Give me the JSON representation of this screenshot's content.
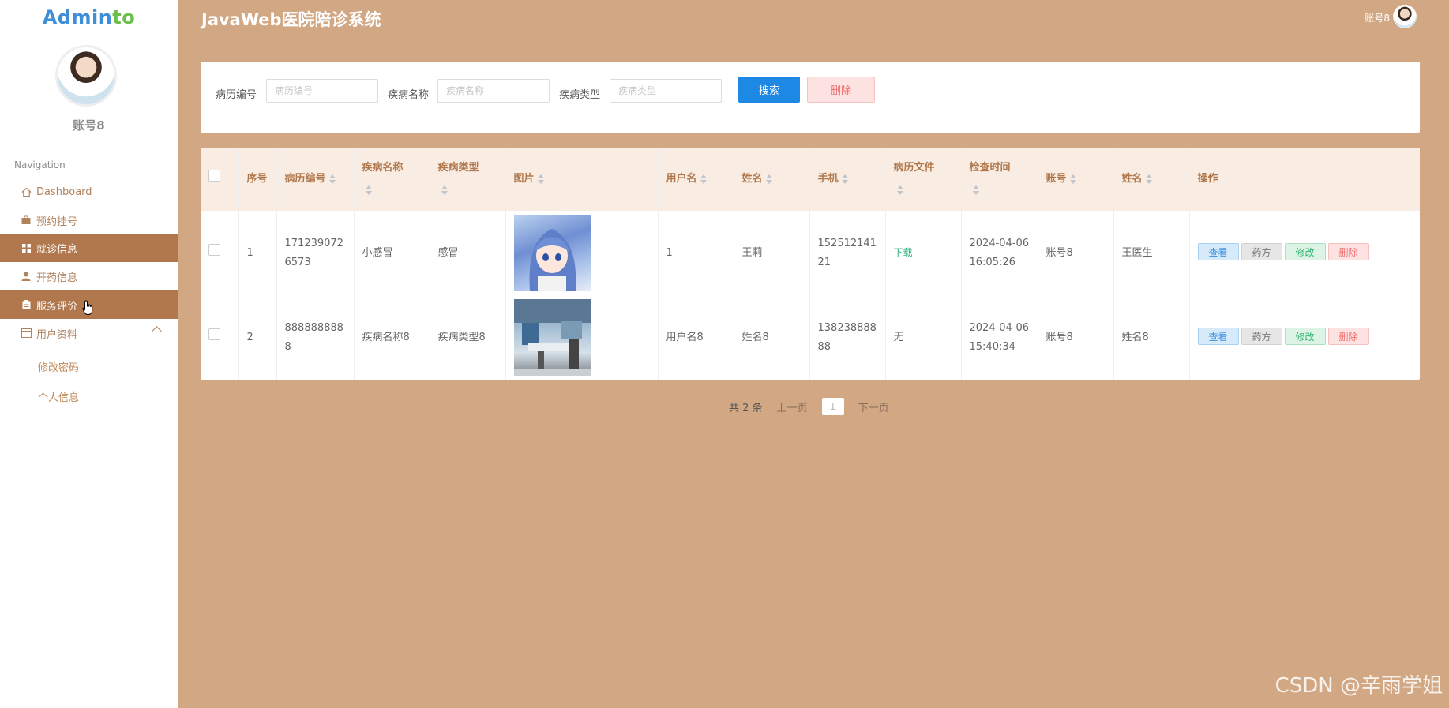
{
  "app": {
    "logo": "Adminto",
    "title": "JavaWeb医院陪诊系统",
    "username": "账号8",
    "header_user": "账号8"
  },
  "sidebar": {
    "heading": "Navigation",
    "items": [
      {
        "label": "Dashboard",
        "icon": "home-icon",
        "active": false
      },
      {
        "label": "预约挂号",
        "icon": "briefcase-icon",
        "active": false
      },
      {
        "label": "就诊信息",
        "icon": "grid-icon",
        "active": true
      },
      {
        "label": "开药信息",
        "icon": "user-icon",
        "active": false
      },
      {
        "label": "服务评价",
        "icon": "clipboard-icon",
        "active": true
      },
      {
        "label": "用户资料",
        "icon": "profile-card-icon",
        "active": false
      }
    ],
    "sub_items": [
      {
        "label": "修改密码"
      },
      {
        "label": "个人信息"
      }
    ]
  },
  "search": {
    "fields": [
      {
        "label": "病历编号",
        "placeholder": "病历编号",
        "value": ""
      },
      {
        "label": "疾病名称",
        "placeholder": "疾病名称",
        "value": ""
      },
      {
        "label": "疾病类型",
        "placeholder": "疾病类型",
        "value": ""
      }
    ],
    "search_button": "搜索",
    "delete_button": "删除"
  },
  "table": {
    "headers": [
      "序号",
      "病历编号",
      "疾病名称",
      "疾病类型",
      "图片",
      "用户名",
      "姓名",
      "手机",
      "病历文件",
      "检查时间",
      "账号",
      "姓名",
      "操作"
    ],
    "rows": [
      {
        "index": "1",
        "record_no": "1712390726573",
        "disease_name": "小感冒",
        "disease_type": "感冒",
        "image": "anime-girl-image",
        "user_name": "1",
        "name": "王莉",
        "phone": "15251214121",
        "file": "下载",
        "check_time": "2024-04-06 16:05:26",
        "account": "账号8",
        "doctor_name": "王医生"
      },
      {
        "index": "2",
        "record_no": "8888888888",
        "disease_name": "疾病名称8",
        "disease_type": "疾病类型8",
        "image": "operating-room-image",
        "user_name": "用户名8",
        "name": "姓名8",
        "phone": "13823888888",
        "file": "无",
        "check_time": "2024-04-06 15:40:34",
        "account": "账号8",
        "doctor_name": "姓名8"
      }
    ],
    "ops": {
      "view": "查看",
      "prescription": "药方",
      "edit": "修改",
      "delete": "删除"
    }
  },
  "pagination": {
    "total": "共 2 条",
    "prev": "上一页",
    "current": "1",
    "next": "下一页"
  },
  "watermark": "CSDN @辛雨学姐",
  "colors": {
    "background": "#d2a784",
    "active_nav": "#b0784c",
    "primary": "#1e88e5"
  }
}
